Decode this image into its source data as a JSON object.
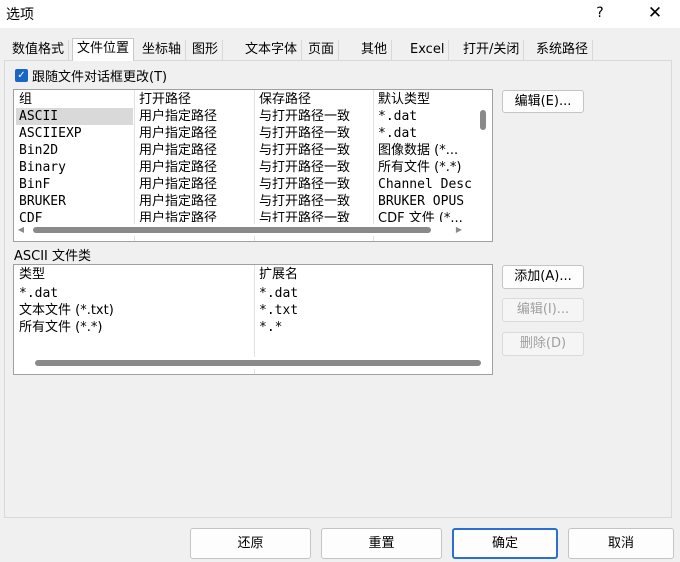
{
  "window": {
    "title": "选项",
    "help_label": "?",
    "close_icon": "close-icon"
  },
  "tabs": [
    {
      "label": "数值格式"
    },
    {
      "label": "文件位置",
      "active": true
    },
    {
      "label": "坐标轴"
    },
    {
      "label": "图形"
    },
    {
      "label": "文本字体"
    },
    {
      "label": "页面"
    },
    {
      "label": "其他"
    },
    {
      "label": "Excel"
    },
    {
      "label": "打开/关闭"
    },
    {
      "label": "系统路径"
    }
  ],
  "follow_dialog": {
    "checked": true,
    "label": "跟随文件对话框更改(T)"
  },
  "file_table": {
    "headers": [
      "组",
      "打开路径",
      "保存路径",
      "默认类型"
    ],
    "rows": [
      [
        "ASCII",
        "用户指定路径",
        "与打开路径一致",
        "*.dat"
      ],
      [
        "ASCIIEXP",
        "用户指定路径",
        "与打开路径一致",
        "*.dat"
      ],
      [
        "Bin2D",
        "用户指定路径",
        "与打开路径一致",
        "图像数据 (*..."
      ],
      [
        "Binary",
        "用户指定路径",
        "与打开路径一致",
        "所有文件 (*.*)"
      ],
      [
        "BinF",
        "用户指定路径",
        "与打开路径一致",
        "Channel Desc..."
      ],
      [
        "BRUKER",
        "用户指定路径",
        "与打开路径一致",
        "BRUKER OPUS ..."
      ],
      [
        "CDF",
        "用户指定路径",
        "与打开路径一致",
        "CDF 文件 (*..."
      ]
    ],
    "selected_row": 0,
    "edit_button": "编辑(E)..."
  },
  "ascii_section": {
    "title": "ASCII 文件类",
    "headers": [
      "类型",
      "扩展名"
    ],
    "rows": [
      [
        "*.dat",
        "*.dat"
      ],
      [
        "文本文件 (*.txt)",
        "*.txt"
      ],
      [
        "所有文件 (*.*)",
        "*.*"
      ]
    ],
    "add_button": "添加(A)...",
    "edit_button": "编辑(I)...",
    "delete_button": "删除(D)"
  },
  "footer": {
    "restore": "还原",
    "reset": "重置",
    "ok": "确定",
    "cancel": "取消"
  }
}
